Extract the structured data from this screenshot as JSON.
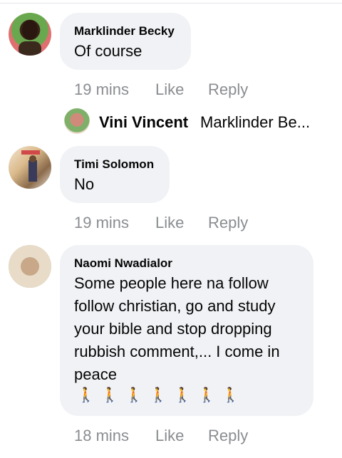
{
  "comments": [
    {
      "author": "Marklinder Becky",
      "text_lines": [
        "Of course"
      ],
      "time": "19 mins",
      "like_label": "Like",
      "reply_label": "Reply",
      "avatar_icon": "user-avatar-photo"
    },
    {
      "author": "Timi Solomon",
      "text_lines": [
        "No"
      ],
      "time": "19 mins",
      "like_label": "Like",
      "reply_label": "Reply",
      "avatar_icon": "user-avatar-photo"
    },
    {
      "author": "Naomi Nwadialor",
      "text_lines": [
        "Some people here na follow",
        "follow christian, go and study",
        "your bible and stop dropping",
        "rubbish comment,... I come in",
        "peace"
      ],
      "emoji_line": "🚶🚶🚶🚶🚶🚶🚶",
      "time": "18 mins",
      "like_label": "Like",
      "reply_label": "Reply",
      "avatar_icon": "user-avatar-photo"
    }
  ],
  "reply_preview": {
    "author": "Vini Vincent",
    "text": "Marklinder Be..."
  },
  "colors": {
    "bubble_bg": "#f0f2f5",
    "meta_text": "#8a8d91",
    "primary_text": "#050505"
  }
}
